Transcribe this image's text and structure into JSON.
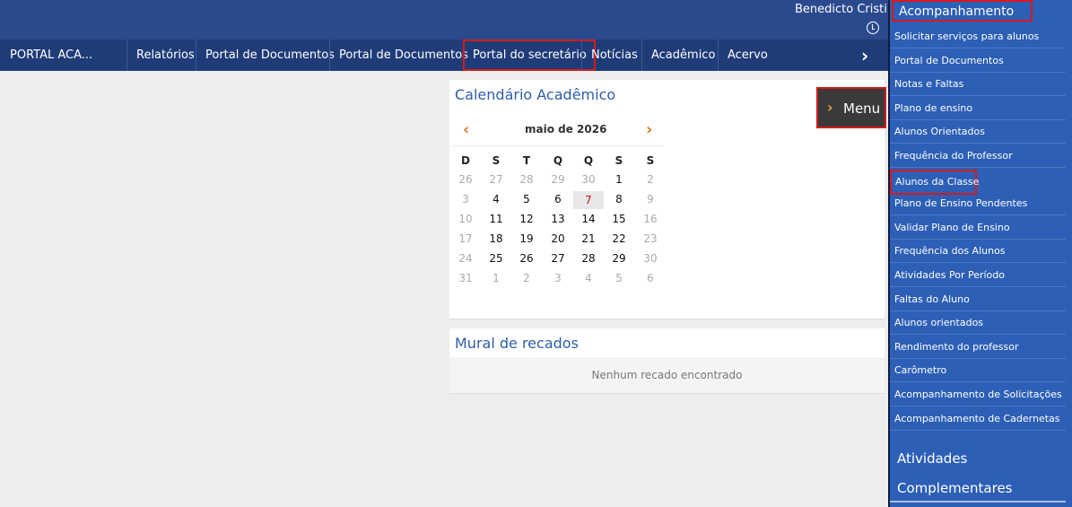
{
  "header": {
    "username": "Benedicto Cristi"
  },
  "nav": {
    "brand": "PORTAL ACA...",
    "items": [
      "Relatórios",
      "Portal de Documentos",
      "Portal de Documentos",
      "Portal do secretário",
      "Notícias",
      "Acadêmico",
      "Acervo"
    ],
    "active": "Portal do secretário"
  },
  "calendar": {
    "title": "Calendário Acadêmico",
    "month": "maio de 2026",
    "weekdays": [
      "D",
      "S",
      "T",
      "Q",
      "Q",
      "S",
      "S"
    ],
    "weeks": [
      [
        "26",
        "27",
        "28",
        "29",
        "30",
        "1",
        "2"
      ],
      [
        "3",
        "4",
        "5",
        "6",
        "7",
        "8",
        "9"
      ],
      [
        "10",
        "11",
        "12",
        "13",
        "14",
        "15",
        "16"
      ],
      [
        "17",
        "18",
        "19",
        "20",
        "21",
        "22",
        "23"
      ],
      [
        "24",
        "25",
        "26",
        "27",
        "28",
        "29",
        "30"
      ],
      [
        "31",
        "1",
        "2",
        "3",
        "4",
        "5",
        "6"
      ]
    ],
    "today": "7"
  },
  "mural": {
    "title": "Mural de recados",
    "empty_message": "Nenhum recado encontrado"
  },
  "menu_button": {
    "label": "Menu"
  },
  "side_panel": {
    "header": "Acompanhamento",
    "items": [
      "Solicitar serviços para alunos",
      "Portal de Documentos",
      "Notas e Faltas",
      "Plano de ensino",
      "Alunos Orientados",
      "Frequência do Professor",
      "Alunos da Classe",
      "Plano de Ensino Pendentes",
      "Validar Plano de Ensino",
      "Frequência dos Alunos",
      "Atividades Por Período",
      "Faltas do Aluno",
      "Alunos orientados",
      "Rendimento do professor",
      "Carômetro",
      "Acompanhamento de Solicitações",
      "Acompanhamento de Cadernetas"
    ],
    "highlighted": "Alunos da Classe",
    "sections": [
      "Atividades",
      "Complementares"
    ]
  },
  "colors": {
    "topbar": "#2b4a8e",
    "navbar": "#1f3c78",
    "panel": "#2d5fb6",
    "accent": "#e07b21",
    "highlight": "#d61a1a"
  }
}
